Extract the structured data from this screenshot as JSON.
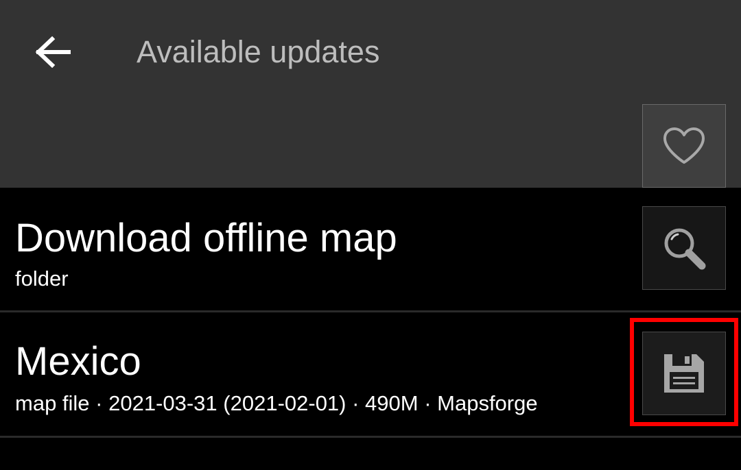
{
  "header": {
    "title": "Available updates",
    "back_icon": "arrow-left-icon",
    "favorite_icon": "heart-icon"
  },
  "list": {
    "items": [
      {
        "title": "Download offline map",
        "subtitle": "folder",
        "action_icon": "search-icon"
      },
      {
        "title": "Mexico",
        "subtitle": "map file · 2021-03-31 (2021-02-01) · 490M · Mapsforge",
        "action_icon": "floppy-disk-icon"
      }
    ]
  },
  "colors": {
    "header_bg": "#333333",
    "list_bg": "#000000",
    "title_text": "#bdbdbd",
    "highlight": "#ff0000"
  }
}
